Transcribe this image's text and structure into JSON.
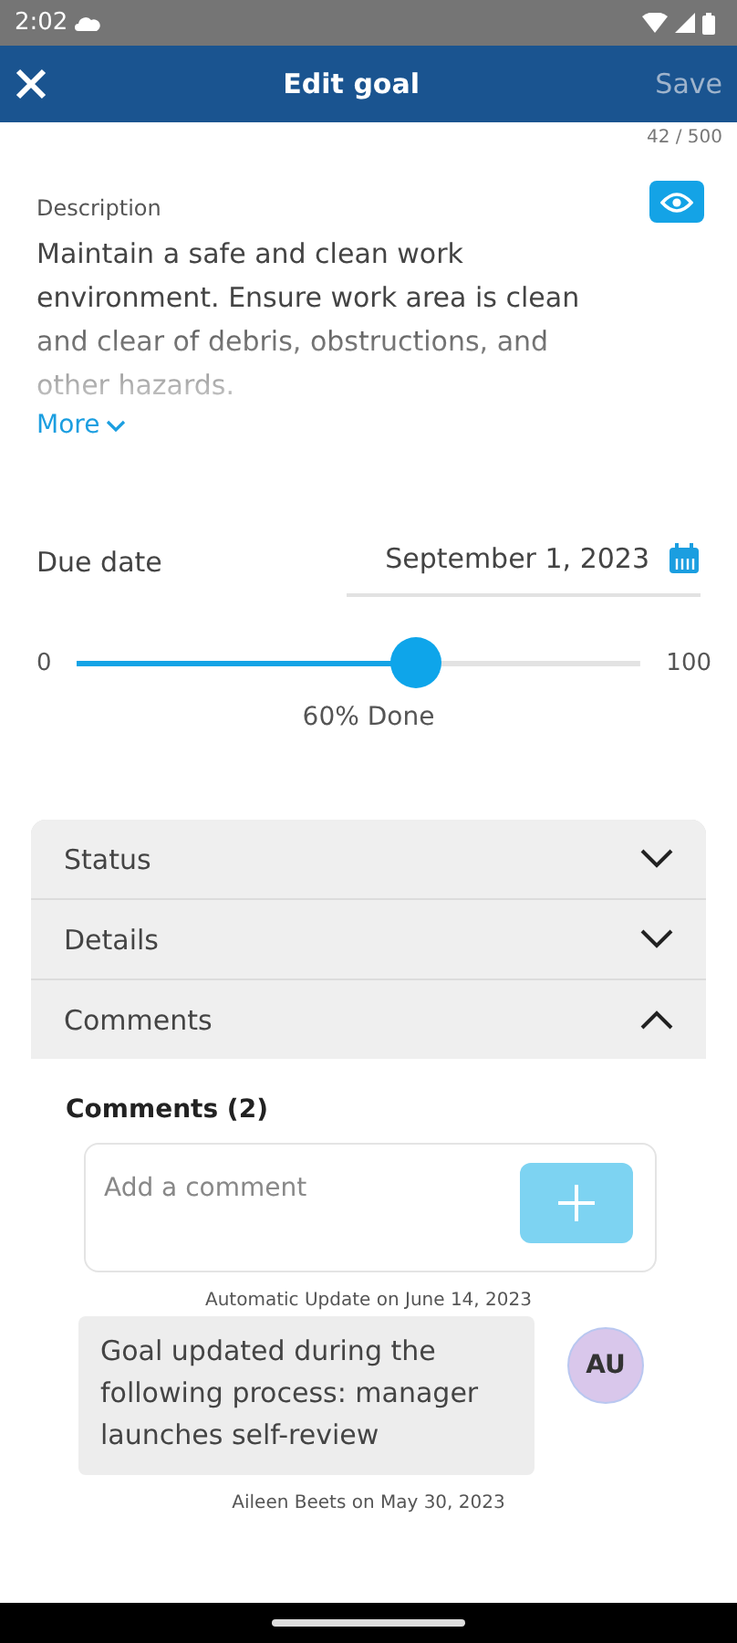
{
  "status_bar": {
    "time": "2:02"
  },
  "app_bar": {
    "title": "Edit goal",
    "save": "Save",
    "save_disabled": true
  },
  "counter": "42 / 500",
  "description": {
    "label": "Description",
    "text": "Maintain a safe and clean work environment. Ensure work area is clean and clear of debris, obstructions, and other hazards.",
    "more": "More"
  },
  "due_date": {
    "label": "Due date",
    "value": "September 1, 2023"
  },
  "progress": {
    "min": "0",
    "max": "100",
    "level": 0.6,
    "reading": "60% Done"
  },
  "sections": [
    {
      "label": "Status",
      "expanded": false
    },
    {
      "label": "Details",
      "expanded": false
    },
    {
      "label": "Comments",
      "expanded": true
    }
  ],
  "comments": {
    "heading": "Comments (2)",
    "placeholder": "Add a comment",
    "items": [
      {
        "meta": "Automatic Update on June 14, 2023",
        "text": "Goal updated during the following process: manager launches self-review",
        "initials": "AU"
      },
      {
        "meta": "Aileen Beets on May 30, 2023"
      }
    ]
  }
}
